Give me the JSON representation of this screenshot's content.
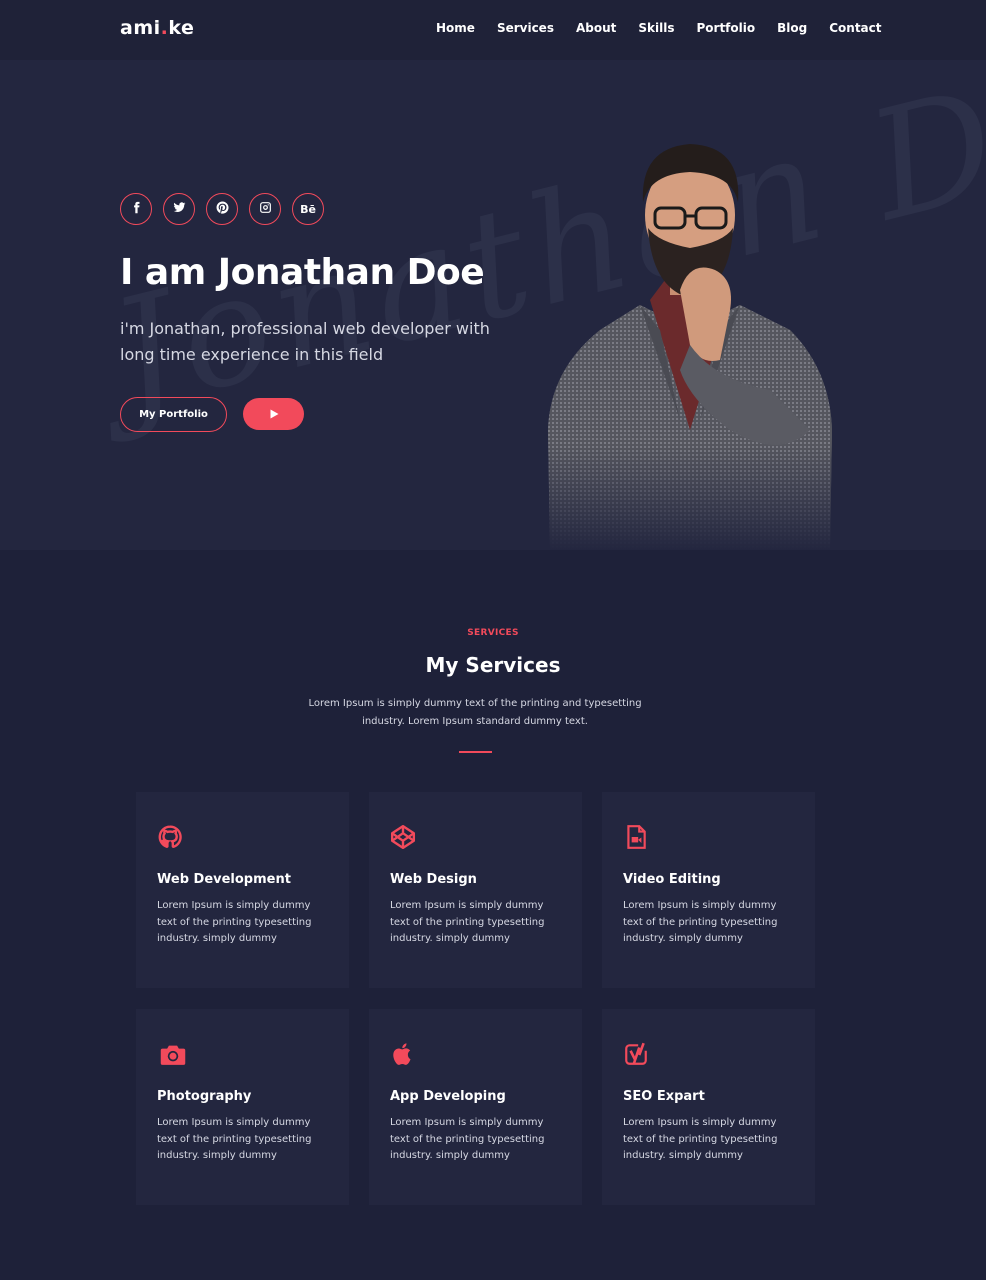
{
  "nav": {
    "logo_main": "ami",
    "logo_dot": ".",
    "logo_end": "ke",
    "items": [
      "Home",
      "Services",
      "About",
      "Skills",
      "Portfolio",
      "Blog",
      "Contact"
    ]
  },
  "hero": {
    "socials": [
      "facebook-icon",
      "twitter-icon",
      "pinterest-icon",
      "instagram-icon",
      "behance-icon"
    ],
    "behance_label": "Bē",
    "title": "I am Jonathan Doe",
    "subtitle": "i'm Jonathan, professional web developer with long time experience in this field",
    "portfolio_button": "My Portfolio",
    "watermark": "Jonathan Doe"
  },
  "services": {
    "eyebrow": "SERVICES",
    "title": "My Services",
    "description": "Lorem Ipsum is simply dummy text of the printing and typesetting industry. Lorem Ipsum standard dummy text.",
    "cards": [
      {
        "icon": "github-icon",
        "title": "Web Development",
        "text": "Lorem Ipsum is simply dummy text of the printing typesetting industry. simply dummy"
      },
      {
        "icon": "codepen-icon",
        "title": "Web Design",
        "text": "Lorem Ipsum is simply dummy text of the printing typesetting industry. simply dummy"
      },
      {
        "icon": "video-file-icon",
        "title": "Video Editing",
        "text": "Lorem Ipsum is simply dummy text of the printing typesetting industry. simply dummy"
      },
      {
        "icon": "camera-icon",
        "title": "Photography",
        "text": "Lorem Ipsum is simply dummy text of the printing typesetting industry. simply dummy"
      },
      {
        "icon": "apple-icon",
        "title": "App Developing",
        "text": "Lorem Ipsum is simply dummy text of the printing typesetting industry. simply dummy"
      },
      {
        "icon": "yoast-icon",
        "title": "SEO Expart",
        "text": "Lorem Ipsum is simply dummy text of the printing typesetting industry. simply dummy"
      }
    ]
  },
  "colors": {
    "accent": "#f24a5b",
    "background": "#1e2139",
    "hero_background": "#23263f",
    "card_background": "#23263f"
  }
}
